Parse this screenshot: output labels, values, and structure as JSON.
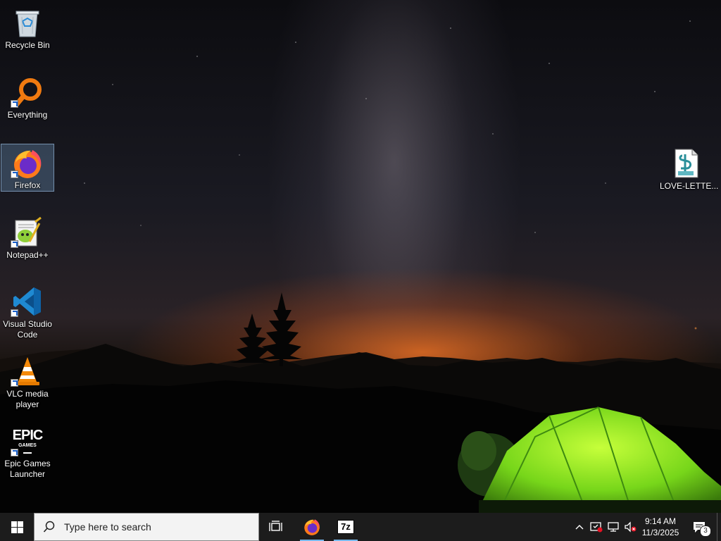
{
  "desktop": {
    "left_icons": [
      {
        "label": "Recycle Bin"
      },
      {
        "label": "Everything"
      },
      {
        "label": "Firefox"
      },
      {
        "label": "Notepad++"
      },
      {
        "label_line1": "Visual Studio",
        "label_line2": "Code"
      },
      {
        "label_line1": "VLC media",
        "label_line2": "player"
      },
      {
        "label_line1": "Epic Games",
        "label_line2": "Launcher",
        "logo_top": "EPIC",
        "logo_bottom": "GAMES"
      }
    ],
    "right_icons": [
      {
        "label": "LOVE-LETTE..."
      }
    ]
  },
  "taskbar": {
    "search_placeholder": "Type here to search",
    "time": "9:14 AM",
    "date": "11/3/2025",
    "notification_count": "3",
    "pinned": [
      {
        "name": "firefox",
        "active": true
      },
      {
        "name": "7-zip",
        "active": true,
        "text": "7z"
      }
    ]
  },
  "colors": {
    "taskbar_bg": "#1c1c1c",
    "accent": "#76b9ed",
    "selection": "#6e96be"
  }
}
